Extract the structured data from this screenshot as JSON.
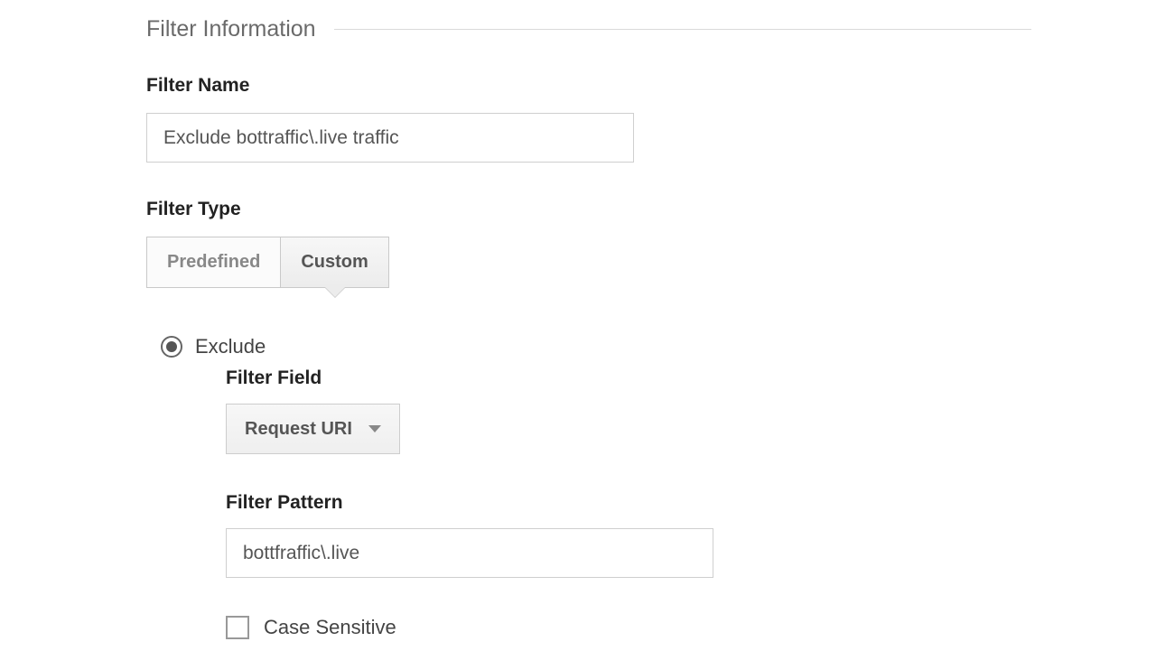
{
  "section": {
    "title": "Filter Information"
  },
  "filter_name": {
    "label": "Filter Name",
    "value": "Exclude bottraffic\\.live traffic"
  },
  "filter_type": {
    "label": "Filter Type",
    "options": {
      "predefined": "Predefined",
      "custom": "Custom"
    },
    "selected": "custom"
  },
  "custom": {
    "exclude_label": "Exclude",
    "exclude_selected": true,
    "filter_field": {
      "label": "Filter Field",
      "value": "Request URI"
    },
    "filter_pattern": {
      "label": "Filter Pattern",
      "value": "bottfraffic\\.live"
    },
    "case_sensitive": {
      "label": "Case Sensitive",
      "checked": false
    }
  }
}
